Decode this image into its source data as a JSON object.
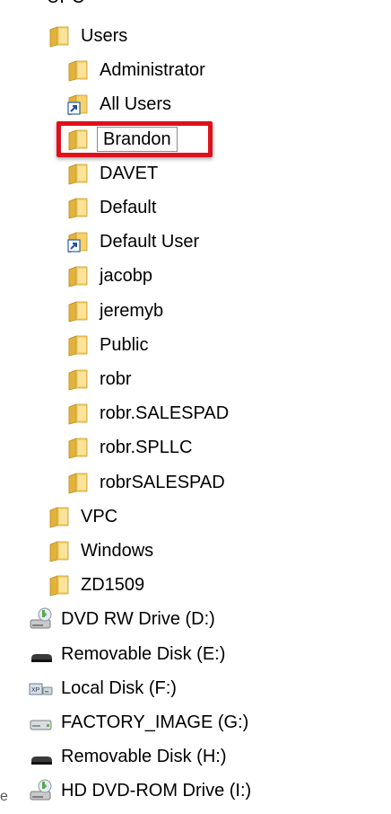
{
  "tree": {
    "partial_top": {
      "label": "UPC",
      "icon": "folder-icon"
    },
    "items": [
      {
        "label": "Users",
        "icon": "folder-icon",
        "level": 1
      },
      {
        "label": "Administrator",
        "icon": "folder-icon",
        "level": 2
      },
      {
        "label": "All Users",
        "icon": "shortcut-folder-icon",
        "level": 2
      },
      {
        "label": "Brandon",
        "icon": "folder-icon",
        "level": 2,
        "editing": true
      },
      {
        "label": "DAVET",
        "icon": "folder-icon",
        "level": 2
      },
      {
        "label": "Default",
        "icon": "folder-icon",
        "level": 2
      },
      {
        "label": "Default User",
        "icon": "shortcut-folder-icon",
        "level": 2
      },
      {
        "label": "jacobp",
        "icon": "folder-icon",
        "level": 2
      },
      {
        "label": "jeremyb",
        "icon": "folder-icon",
        "level": 2
      },
      {
        "label": "Public",
        "icon": "folder-icon",
        "level": 2
      },
      {
        "label": "robr",
        "icon": "folder-icon",
        "level": 2
      },
      {
        "label": "robr.SALESPAD",
        "icon": "folder-icon",
        "level": 2
      },
      {
        "label": "robr.SPLLC",
        "icon": "folder-icon",
        "level": 2
      },
      {
        "label": "robrSALESPAD",
        "icon": "folder-icon",
        "level": 2
      },
      {
        "label": "VPC",
        "icon": "folder-icon",
        "level": 1
      },
      {
        "label": "Windows",
        "icon": "folder-icon",
        "level": 1
      },
      {
        "label": "ZD1509",
        "icon": "folder-icon",
        "level": 1
      },
      {
        "label": "DVD RW Drive (D:)",
        "icon": "dvd-drive-icon",
        "level": 0
      },
      {
        "label": "Removable Disk (E:)",
        "icon": "removable-disk-icon",
        "level": 0
      },
      {
        "label": "Local Disk (F:)",
        "icon": "local-disk-icon",
        "level": 0
      },
      {
        "label": "FACTORY_IMAGE (G:)",
        "icon": "hard-drive-icon",
        "level": 0
      },
      {
        "label": "Removable Disk (H:)",
        "icon": "removable-disk-icon",
        "level": 0
      },
      {
        "label": "HD DVD-ROM Drive (I:)",
        "icon": "dvd-drive-icon",
        "level": 0
      }
    ]
  },
  "highlight_color": "#e0101a",
  "stray_char": "e"
}
